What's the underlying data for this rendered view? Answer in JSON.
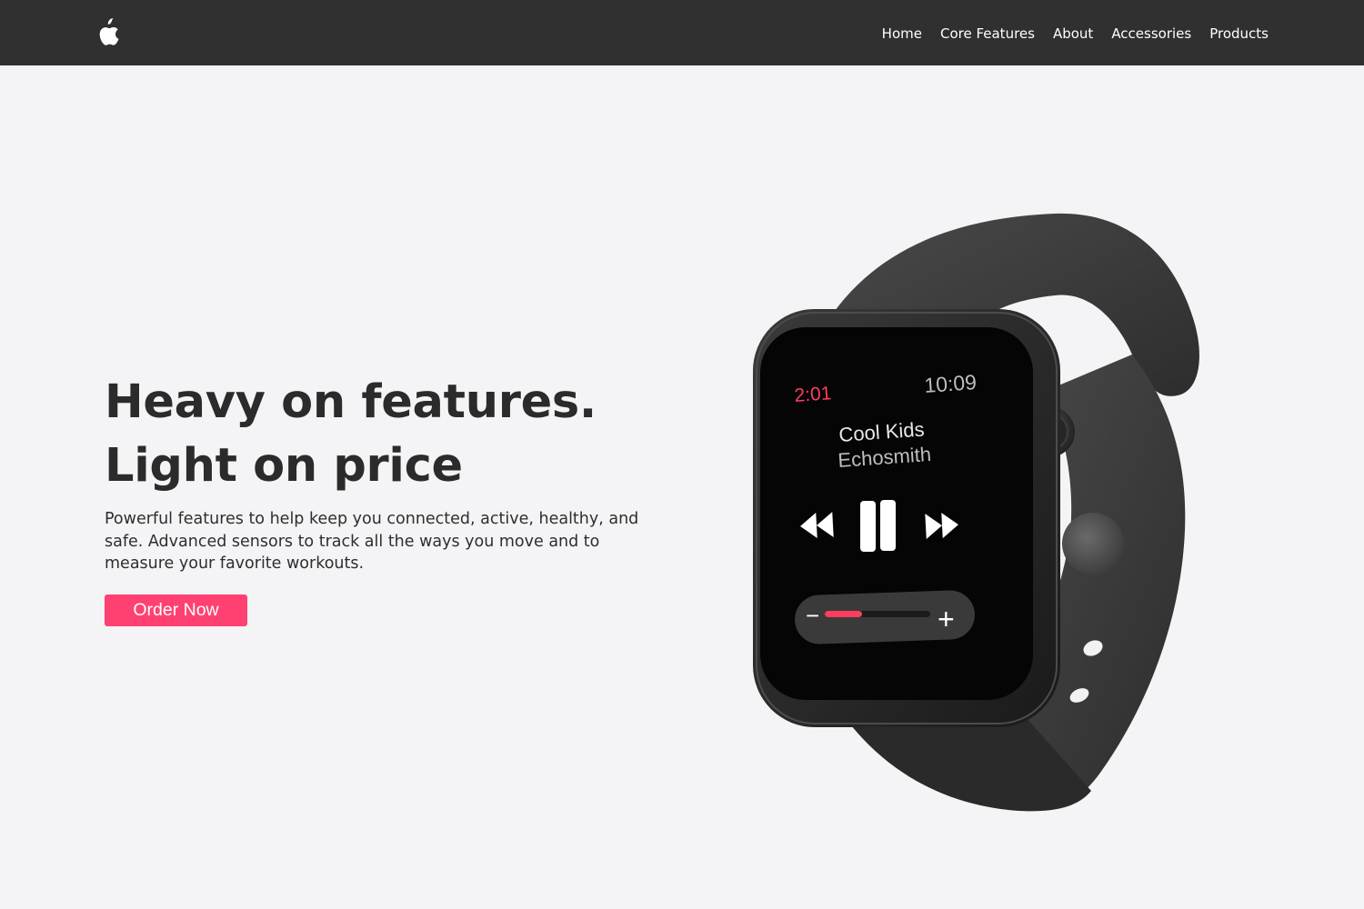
{
  "nav": {
    "logo_icon": "apple-logo-icon",
    "links": [
      {
        "label": "Home"
      },
      {
        "label": "Core Features"
      },
      {
        "label": "About"
      },
      {
        "label": "Accessories"
      },
      {
        "label": "Products"
      }
    ]
  },
  "hero": {
    "title": "Heavy on features. Light on price",
    "description": "Powerful features to help keep you connected, active, healthy, and safe. Advanced sensors to track all the ways you move and to measure your favorite workouts.",
    "cta_label": "Order Now"
  },
  "watch_screen": {
    "elapsed": "2:01",
    "clock": "10:09",
    "song": "Cool Kids",
    "artist": "Echosmith",
    "volume_minus": "−",
    "volume_plus": "+",
    "volume_level": 0.35
  },
  "colors": {
    "navbar": "#303030",
    "background": "#f4f4f6",
    "accent": "#ff4171"
  }
}
